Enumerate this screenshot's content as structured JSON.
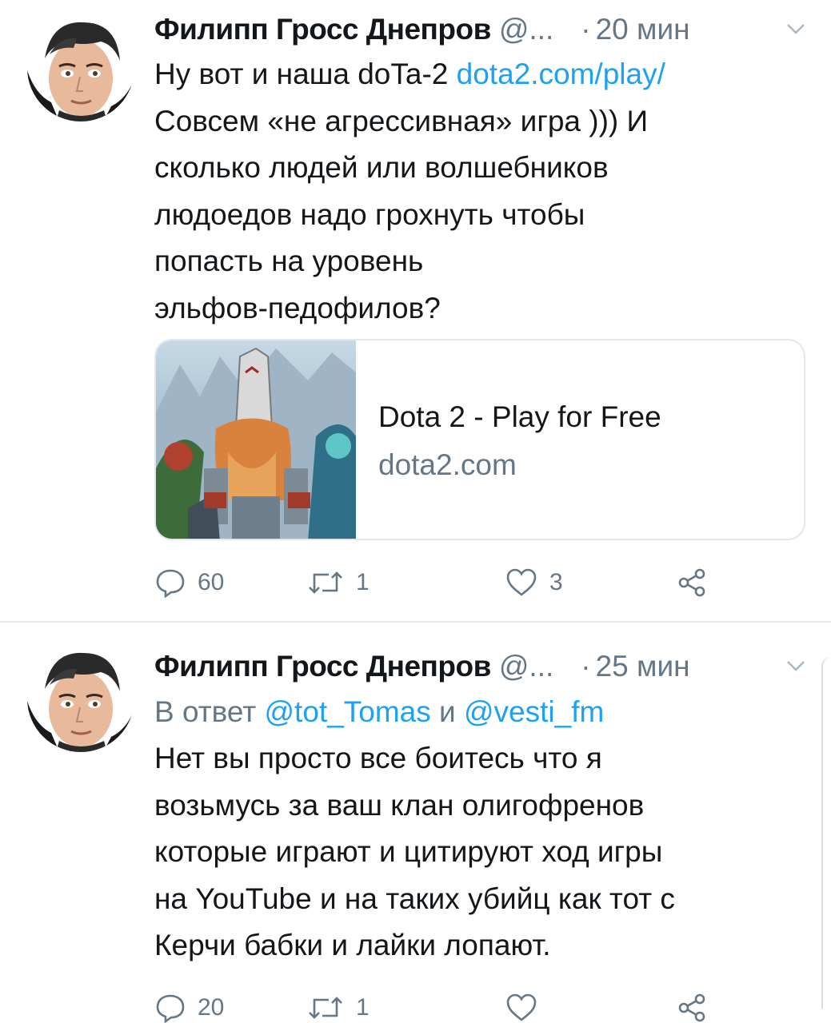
{
  "tweets": [
    {
      "author_name": "Филипп Гросс Днепров",
      "handle": "@...",
      "separator": "·",
      "time": "20 мин",
      "text_before_link": "Ну вот и наша doTa-2 ",
      "link_text": "dota2.com/play/",
      "text_lines": [
        "Совсем «не агрессивная» игра ))) И",
        "сколько людей или волшебников",
        "людоедов надо грохнуть чтобы",
        "попасть на уровень",
        "эльфов-педофилов?"
      ],
      "card": {
        "title": "Dota 2 - Play for Free",
        "domain": "dota2.com"
      },
      "actions": {
        "replies": "60",
        "retweets": "1",
        "likes": "3"
      }
    },
    {
      "author_name": "Филипп Гросс Днепров",
      "handle": "@...",
      "separator": "·",
      "time": "25 мин",
      "reply_prefix": "В ответ ",
      "reply_user1": "@tot_Tomas",
      "reply_and": " и ",
      "reply_user2": "@vesti_fm",
      "text_lines": [
        "Нет вы просто все боитесь что я",
        "возьмусь за ваш клан олигофренов",
        "которые играют и цитируют ход игры",
        "на YouTube и на таких убийц как тот с",
        "Керчи бабки и лайки лопают."
      ],
      "actions": {
        "replies": "20",
        "retweets": "1",
        "likes": ""
      }
    }
  ],
  "colors": {
    "link": "#1da1f2",
    "secondary": "#657786",
    "text": "#14171a",
    "divider": "#e6ecf0"
  },
  "icons": [
    "avatar",
    "chevron-down-icon",
    "reply-icon",
    "retweet-icon",
    "like-icon",
    "share-icon"
  ]
}
